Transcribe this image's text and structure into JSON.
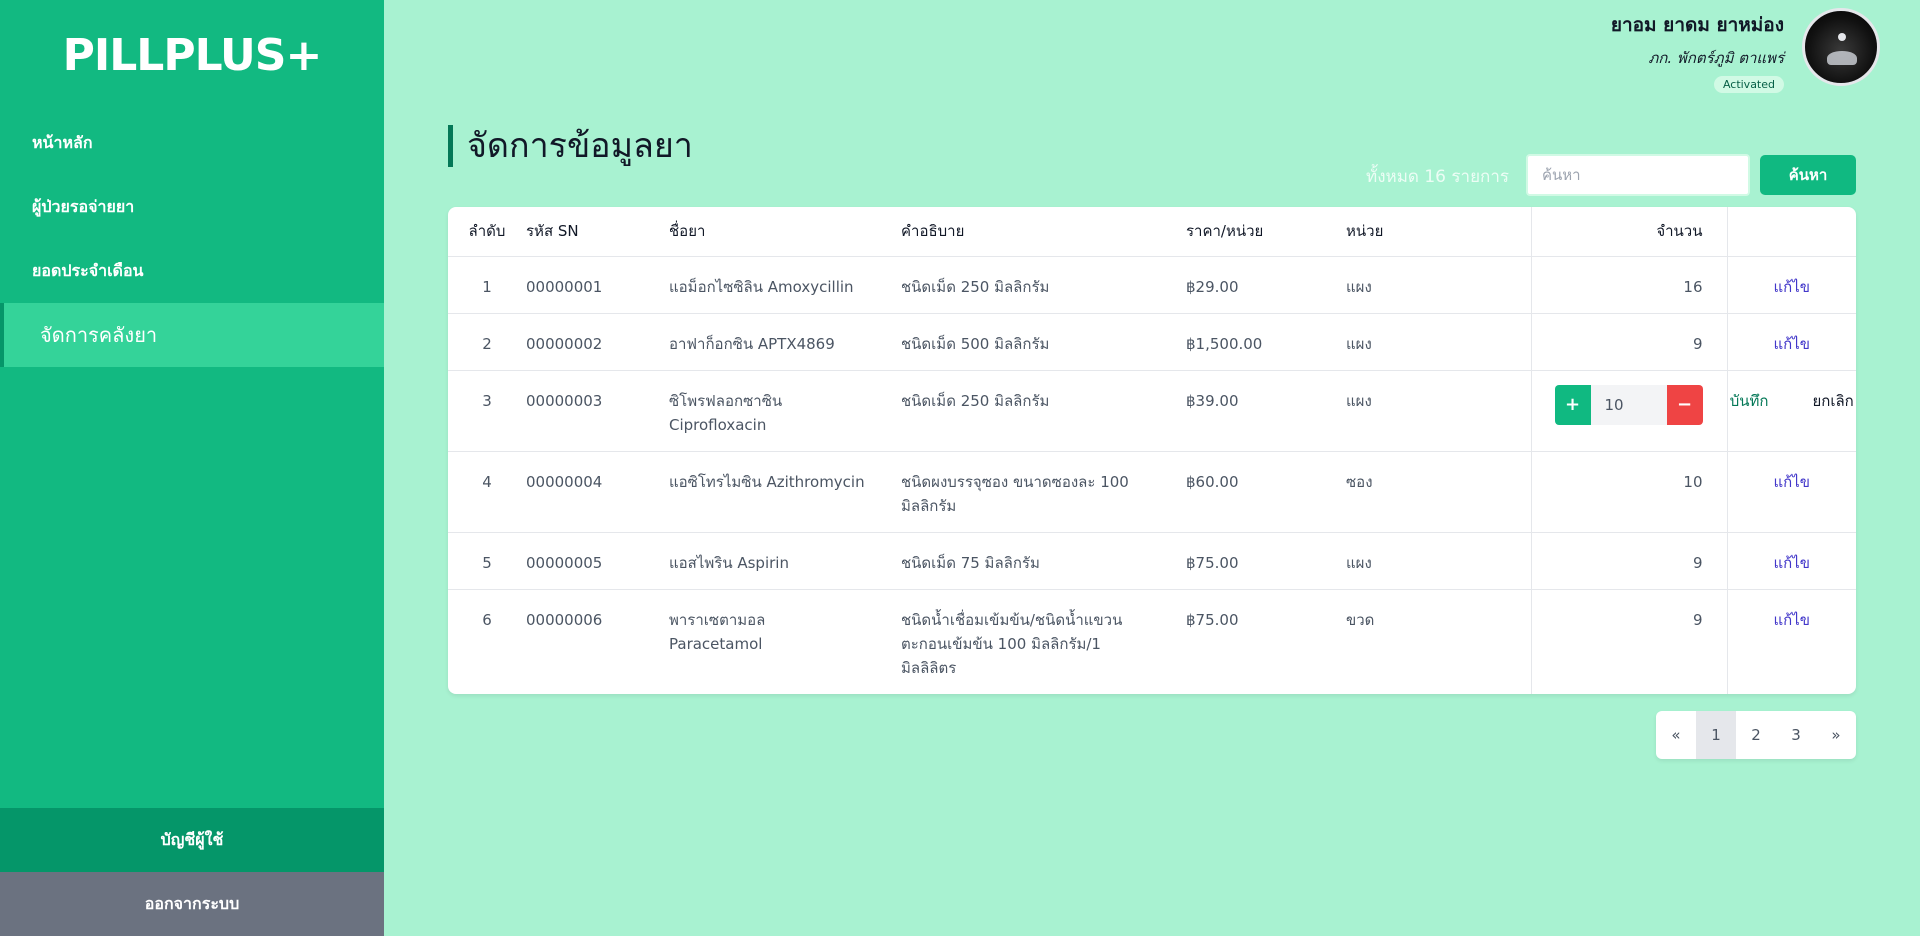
{
  "brand": {
    "logo": "PILLPLUS+"
  },
  "sidebar": {
    "items": [
      {
        "label": "หน้าหลัก"
      },
      {
        "label": "ผู้ป่วยรอจ่ายยา"
      },
      {
        "label": "ยอดประจำเดือน"
      },
      {
        "label": "จัดการคลังยา"
      }
    ],
    "account_label": "บัญชีผู้ใช้",
    "logout_label": "ออกจากระบบ"
  },
  "user": {
    "name": "ยาอม ยาดม ยาหม่อง",
    "role": "ภก. พักตร์ภูมิ ตาแพร่",
    "status": "Activated"
  },
  "main": {
    "title": "จัดการข้อมูลยา",
    "total_text": "ทั้งหมด 16 รายการ",
    "search_placeholder": "ค้นหา",
    "search_button": "ค้นหา"
  },
  "table": {
    "headers": {
      "no": "ลำดับ",
      "sn": "รหัส SN",
      "name": "ชื่อยา",
      "desc": "คำอธิบาย",
      "price": "ราคา/หน่วย",
      "unit": "หน่วย",
      "qty": "จำนวน"
    },
    "rows": [
      {
        "no": "1",
        "sn": "00000001",
        "name": "แอม็อกไซซิลิน Amoxycillin",
        "desc": "ชนิดเม็ด 250 มิลลิกรัม",
        "price": "฿29.00",
        "unit": "แผง",
        "qty": "16",
        "action": "แก้ไข"
      },
      {
        "no": "2",
        "sn": "00000002",
        "name": "อาฟาก็อกซิน APTX4869",
        "desc": "ชนิดเม็ด 500 มิลลิกรัม",
        "price": "฿1,500.00",
        "unit": "แผง",
        "qty": "9",
        "action": "แก้ไข"
      },
      {
        "no": "3",
        "sn": "00000003",
        "name": "ซิโพรฟลอกซาซิน Ciprofloxacin",
        "desc": "ชนิดเม็ด 250 มิลลิกรัม",
        "price": "฿39.00",
        "unit": "แผง",
        "qty_input": "10",
        "save": "บันทึก",
        "cancel": "ยกเลิก"
      },
      {
        "no": "4",
        "sn": "00000004",
        "name": "แอซิโทรไมซิน Azithromycin",
        "desc": "ชนิดผงบรรจุซอง ขนาดซองละ 100 มิลลิกรัม",
        "price": "฿60.00",
        "unit": "ซอง",
        "qty": "10",
        "action": "แก้ไข"
      },
      {
        "no": "5",
        "sn": "00000005",
        "name": "แอสไพริน Aspirin",
        "desc": "ชนิดเม็ด 75 มิลลิกรัม",
        "price": "฿75.00",
        "unit": "แผง",
        "qty": "9",
        "action": "แก้ไข"
      },
      {
        "no": "6",
        "sn": "00000006",
        "name": "พาราเซตามอล Paracetamol",
        "desc": "ชนิดน้ำเชื่อมเข้มข้น/ชนิดน้ำแขวนตะกอนเข้มข้น 100 มิลลิกรัม/1 มิลลิลิตร",
        "price": "฿75.00",
        "unit": "ขวด",
        "qty": "9",
        "action": "แก้ไข"
      }
    ]
  },
  "pagination": {
    "prev": "«",
    "pages": [
      "1",
      "2",
      "3"
    ],
    "next": "»",
    "current": "1"
  },
  "colors": {
    "sidebar": "#12b981",
    "sidebar_active": "#34d399",
    "background": "#a8f2d1",
    "accent": "#10b981",
    "danger": "#ef4444",
    "link": "#4338ca"
  }
}
